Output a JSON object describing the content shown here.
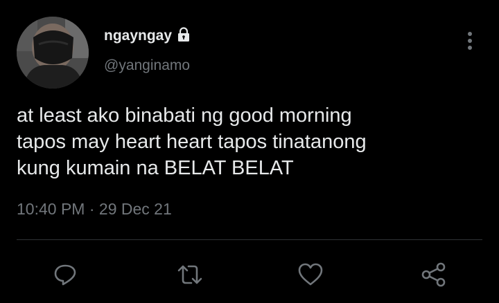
{
  "tweet": {
    "author": {
      "display_name": "ngayngay",
      "handle": "@yanginamo",
      "protected_icon": "lock-icon",
      "avatar_icon": "avatar-masked-person"
    },
    "text_lines": [
      "at least ako binabati ng good morning",
      "tapos may heart heart tapos tinatanong",
      "kung kumain na BELAT BELAT"
    ],
    "time": "10:40 PM",
    "separator": "·",
    "date": "29 Dec 21"
  },
  "actions": [
    {
      "name": "reply",
      "icon": "reply-icon"
    },
    {
      "name": "retweet",
      "icon": "retweet-icon"
    },
    {
      "name": "like",
      "icon": "heart-icon"
    },
    {
      "name": "share",
      "icon": "share-icon"
    }
  ],
  "colors": {
    "background": "#000000",
    "text_primary": "#e7e9ea",
    "text_secondary": "#71767b",
    "divider": "#2f3336"
  }
}
